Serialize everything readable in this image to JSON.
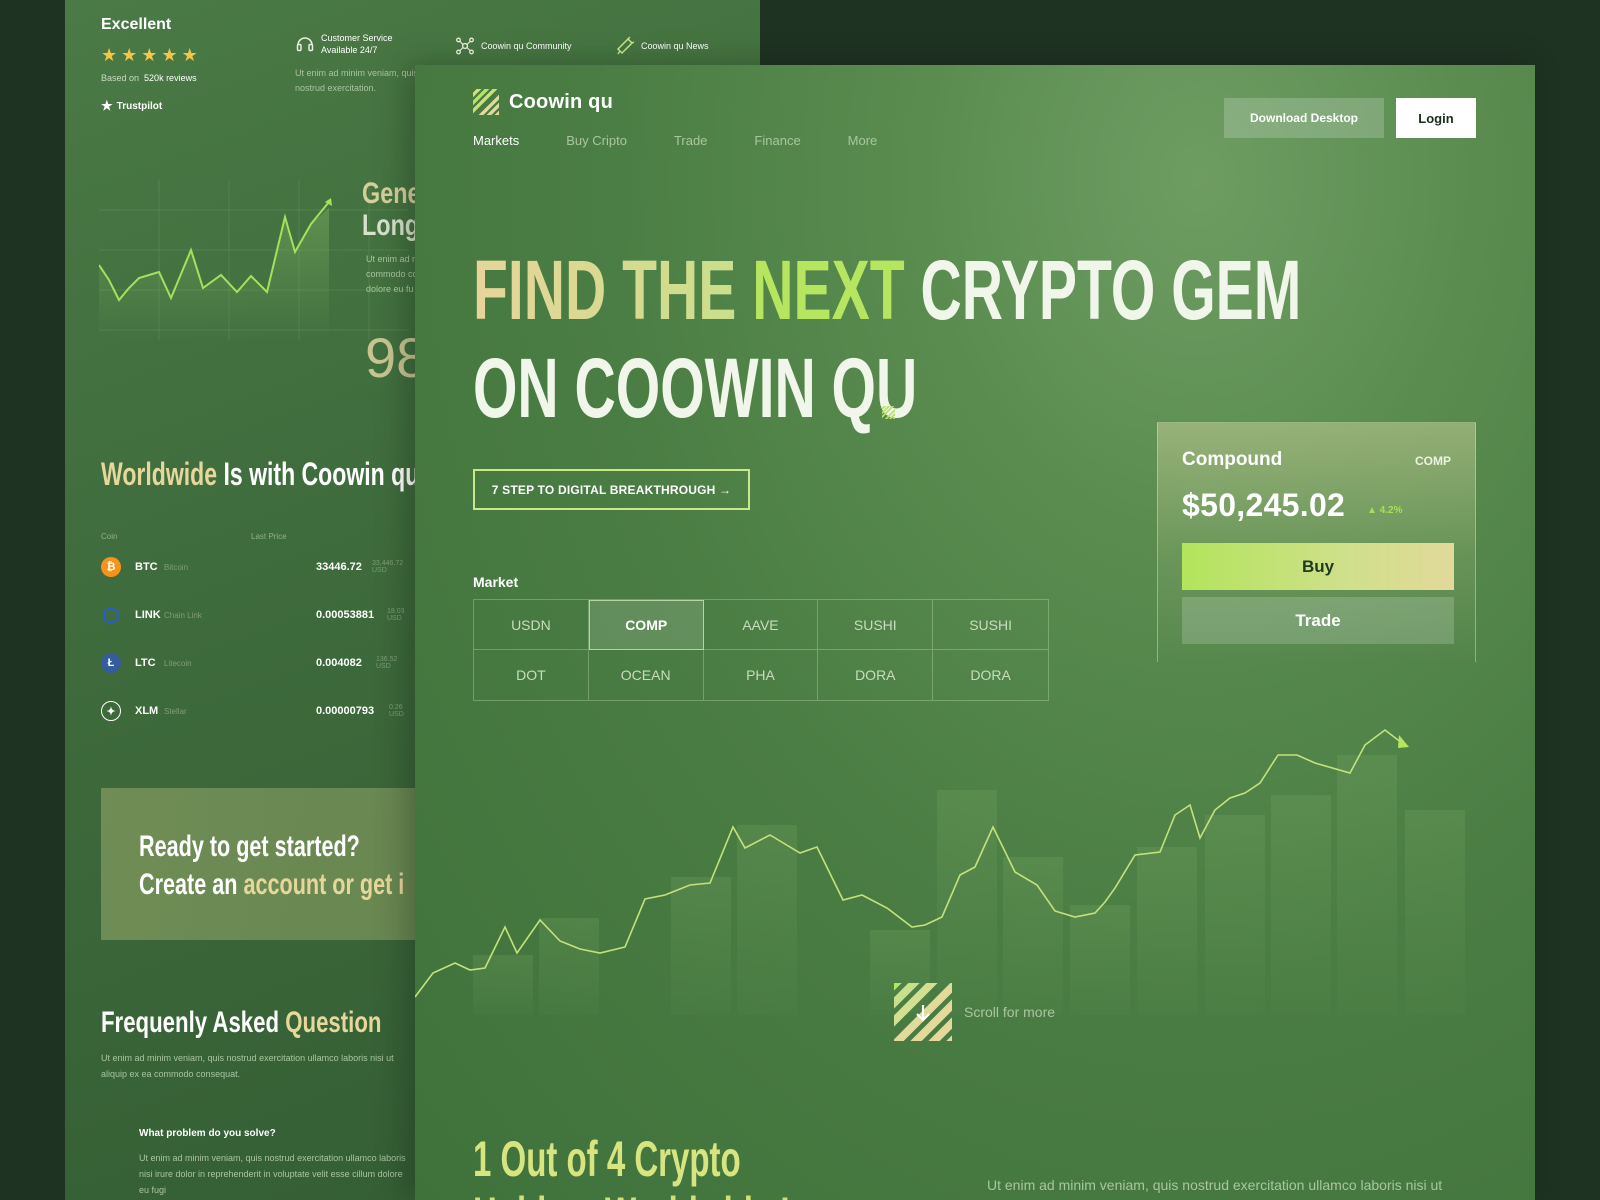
{
  "back": {
    "rating": {
      "title": "Excellent",
      "stars": 5,
      "based_prefix": "Based on",
      "based_count": "520k reviews",
      "trustpilot": "Trustpilot"
    },
    "features": [
      {
        "label_line1": "Customer Service",
        "label_line2": "Available 24/7",
        "icon": "headset-icon"
      },
      {
        "label_line1": "Coowin qu Community",
        "label_line2": "",
        "icon": "community-icon"
      },
      {
        "label_line1": "Coowin qu News",
        "label_line2": "",
        "icon": "megaphone-icon"
      }
    ],
    "feature_desc": "Ut enim ad minim veniam, quis nostrud exercitation.",
    "gen_line1": "Gene",
    "gen_line2": "Long",
    "gen_desc": "Ut enim ad m commodo co dolore eu fu",
    "big_number": "98",
    "worldwide": {
      "highlight": "Worldwide",
      "rest": " Is with Coowin qu"
    },
    "coins_header": {
      "coin": "Coin",
      "last_price": "Last Price"
    },
    "coins": [
      {
        "sym": "BTC",
        "name": "Bitcoin",
        "price": "33446.72",
        "usd": "33,446.72 USD",
        "color": "#f7931a",
        "glyph": "₿"
      },
      {
        "sym": "LINK",
        "name": "Chain Link",
        "price": "0.00053881",
        "usd": "18.03 USD",
        "color": "#2a5ada",
        "glyph": "⬡"
      },
      {
        "sym": "LTC",
        "name": "Litecoin",
        "price": "0.004082",
        "usd": "136.52 USD",
        "color": "#345d9d",
        "glyph": "Ł"
      },
      {
        "sym": "XLM",
        "name": "Stellar",
        "price": "0.00000793",
        "usd": "0.26 USD",
        "color": "#ffffff",
        "glyph": "✦"
      }
    ],
    "ready": {
      "line1": "Ready to get started?",
      "line2_a": "Create an ",
      "line2_b": "account or get i"
    },
    "faq": {
      "title_a": "Frequenly Asked ",
      "title_b": "Question",
      "desc": "Ut enim ad minim veniam, quis nostrud exercitation ullamco laboris nisi ut aliquip ex ea commodo consequat.",
      "q1": "What problem do you solve?",
      "q1_desc": "Ut enim ad minim veniam, quis nostrud exercitation ullamco laboris nisi irure dolor in reprehenderit in voluptate velit esse cillum dolore eu fugi"
    }
  },
  "front": {
    "brand": "Coowin qu",
    "nav": [
      "Markets",
      "Buy Cripto",
      "Trade",
      "Finance",
      "More"
    ],
    "download_label": "Download Desktop",
    "login_label": "Login",
    "hero": {
      "a": "FIND THE ",
      "b": "NEXT",
      "c": " CRYPTO GEM",
      "line2": "ON COOWIN QU"
    },
    "steps_label": "7 STEP TO DIGITAL BREAKTHROUGH →",
    "market_label": "Market",
    "markets": [
      "USDN",
      "COMP",
      "AAVE",
      "SUSHI",
      "SUSHI",
      "DOT",
      "OCEAN",
      "PHA",
      "DORA",
      "DORA"
    ],
    "selected_market": "COMP",
    "card": {
      "name": "Compound",
      "symbol": "COMP",
      "price": "$50,245.02",
      "change": "▲ 4.2%",
      "buy_label": "Buy",
      "trade_label": "Trade"
    },
    "scroll_label": "Scroll for more",
    "stat_line1": "1 Out of 4 Crypto",
    "stat_line2": "Holders Worldwide Is",
    "stat_desc": "Ut enim ad minim veniam, quis nostrud exercitation ullamco laboris nisi ut"
  },
  "colors": {
    "accent_green": "#b6e65f",
    "accent_gold": "#e6d79a",
    "star": "#f5c543",
    "change_up": "#a5e05a"
  }
}
